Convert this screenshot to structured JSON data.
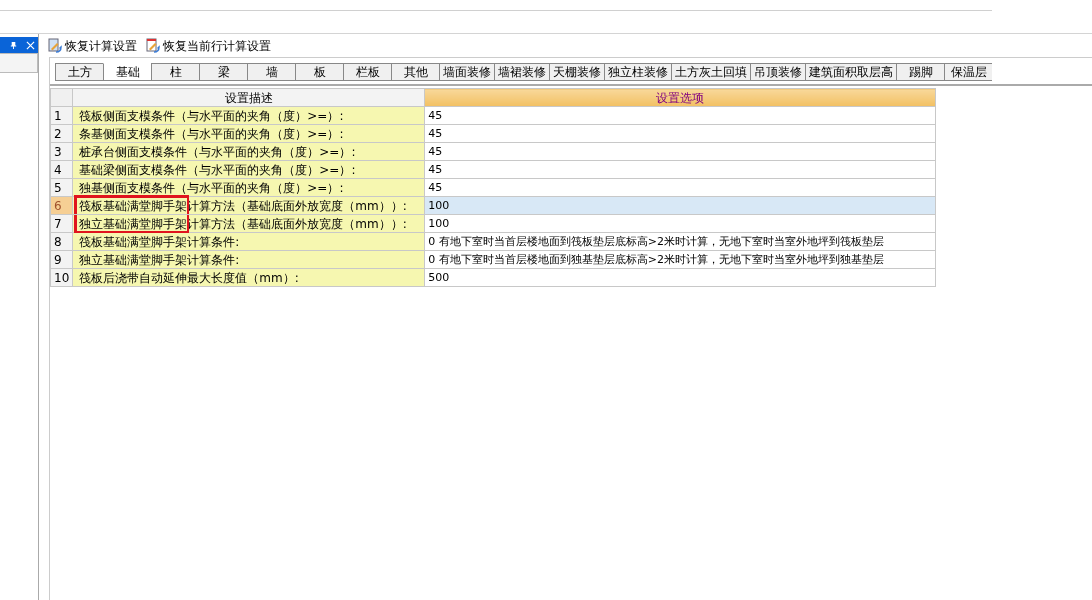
{
  "toolbar": {
    "buttons": [
      "恢复计算设置",
      "恢复当前行计算设置"
    ]
  },
  "tabs": [
    {
      "label": "土方",
      "selected": false
    },
    {
      "label": "基础",
      "selected": true
    },
    {
      "label": "柱",
      "selected": false
    },
    {
      "label": "梁",
      "selected": false
    },
    {
      "label": "墙",
      "selected": false
    },
    {
      "label": "板",
      "selected": false
    },
    {
      "label": "栏板",
      "selected": false
    },
    {
      "label": "其他",
      "selected": false
    },
    {
      "label": "墙面装修",
      "selected": false
    },
    {
      "label": "墙裙装修",
      "selected": false
    },
    {
      "label": "天棚装修",
      "selected": false
    },
    {
      "label": "独立柱装修",
      "selected": false
    },
    {
      "label": "土方灰土回填",
      "selected": false
    },
    {
      "label": "吊顶装修",
      "selected": false
    },
    {
      "label": "建筑面积取层高",
      "selected": false
    },
    {
      "label": "踢脚",
      "selected": false
    },
    {
      "label": "保温层",
      "selected": false
    }
  ],
  "table": {
    "columns": [
      "设置描述",
      "设置选项"
    ],
    "rows": [
      {
        "number": "1",
        "description": "筏板侧面支模条件（与水平面的夹角（度）>=）:",
        "value": "45",
        "selected": false
      },
      {
        "number": "2",
        "description": "条基侧面支模条件（与水平面的夹角（度）>=）:",
        "value": "45",
        "selected": false
      },
      {
        "number": "3",
        "description": "桩承台侧面支模条件（与水平面的夹角（度）>=）:",
        "value": "45",
        "selected": false
      },
      {
        "number": "4",
        "description": "基础梁侧面支模条件（与水平面的夹角（度）>=）:",
        "value": "45",
        "selected": false
      },
      {
        "number": "5",
        "description": "独基侧面支模条件（与水平面的夹角（度）>=）:",
        "value": "45",
        "selected": false
      },
      {
        "number": "6",
        "description": "筏板基础满堂脚手架计算方法（基础底面外放宽度（mm））:",
        "value": "100",
        "selected": true,
        "boxed": true
      },
      {
        "number": "7",
        "description": "独立基础满堂脚手架计算方法（基础底面外放宽度（mm））:",
        "value": "100",
        "selected": false,
        "boxed": true
      },
      {
        "number": "8",
        "description": "筏板基础满堂脚手架计算条件:",
        "value": "0 有地下室时当首层楼地面到筏板垫层底标高>2米时计算，无地下室时当室外地坪到筏板垫层",
        "selected": false
      },
      {
        "number": "9",
        "description": "独立基础满堂脚手架计算条件:",
        "value": "0 有地下室时当首层楼地面到独基垫层底标高>2米时计算，无地下室时当室外地坪到独基垫层",
        "selected": false
      },
      {
        "number": "10",
        "description": "筏板后浇带自动延伸最大长度值（mm）:",
        "value": "500",
        "selected": false
      }
    ]
  }
}
